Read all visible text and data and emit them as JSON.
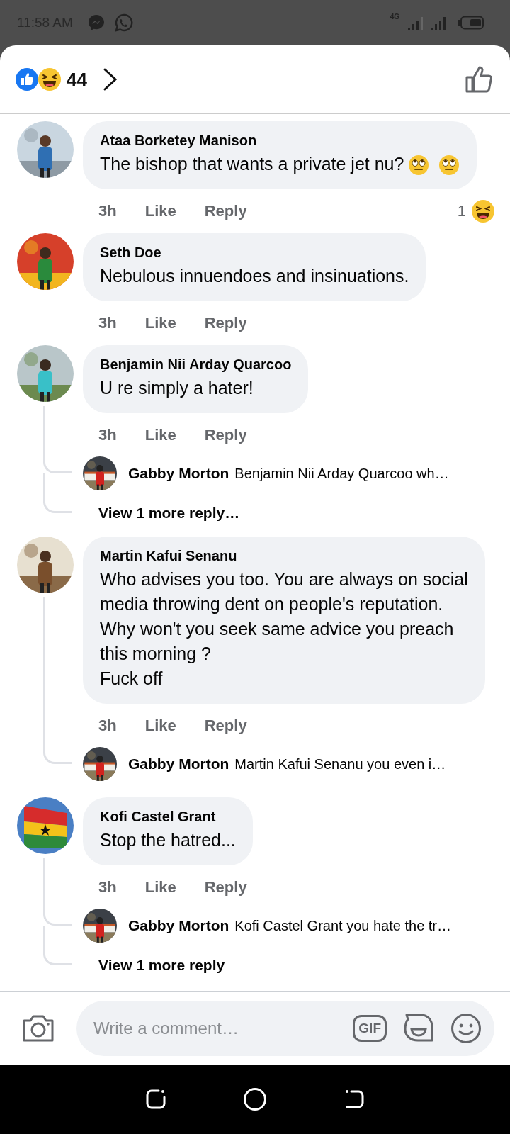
{
  "status_bar": {
    "time": "11:58 AM",
    "network": "4G"
  },
  "header": {
    "reaction_count": "44"
  },
  "comments": [
    {
      "author": "Ataa Borketey Manison",
      "text": "The bishop that wants a private jet nu?",
      "emoji_after": true,
      "time": "3h",
      "like": "Like",
      "reply": "Reply",
      "reaction_count": "1"
    },
    {
      "author": "Seth Doe",
      "text": "Nebulous innuendoes and insinuations.",
      "emoji_after": false,
      "time": "3h",
      "like": "Like",
      "reply": "Reply"
    },
    {
      "author": "Benjamin Nii Arday Quarcoo",
      "text": "U re simply a hater!",
      "emoji_after": false,
      "time": "3h",
      "like": "Like",
      "reply": "Reply",
      "replies": [
        {
          "author": "Gabby Morton",
          "text": "Benjamin Nii Arday Quarcoo wh…"
        }
      ],
      "more_replies": "View 1 more reply…"
    },
    {
      "author": "Martin Kafui Senanu",
      "text": "Who advises you too. You are always on social media throwing dent on people's reputation. Why won't you seek same advice you preach this morning ?\nFuck off",
      "emoji_after": false,
      "time": "3h",
      "like": "Like",
      "reply": "Reply",
      "replies": [
        {
          "author": "Gabby Morton",
          "text": "Martin Kafui Senanu you even i…"
        }
      ]
    },
    {
      "author": "Kofi Castel Grant",
      "text": "Stop the hatred...",
      "emoji_after": false,
      "time": "3h",
      "like": "Like",
      "reply": "Reply",
      "replies": [
        {
          "author": "Gabby Morton",
          "text": "Kofi Castel Grant you hate the tr…"
        }
      ],
      "more_replies": "View 1 more reply"
    }
  ],
  "composer": {
    "placeholder": "Write a comment…",
    "gif_label": "GIF"
  }
}
